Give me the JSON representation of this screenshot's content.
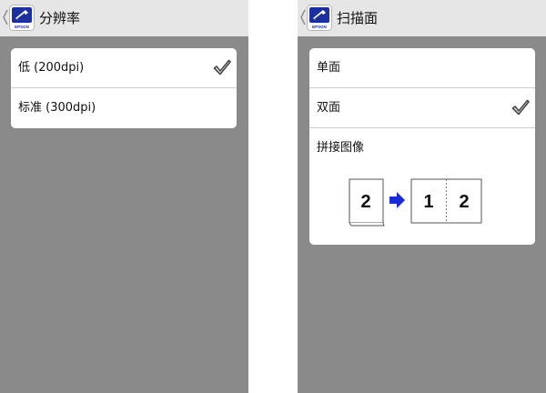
{
  "screens": [
    {
      "title": "分辨率",
      "logo_text": "EPSON",
      "options": [
        {
          "label": "低 (200dpi)",
          "selected": true
        },
        {
          "label": "标准 (300dpi)",
          "selected": false
        }
      ]
    },
    {
      "title": "扫描面",
      "logo_text": "EPSON",
      "options": [
        {
          "label": "单面",
          "selected": false
        },
        {
          "label": "双面",
          "selected": true
        }
      ],
      "merge": {
        "label": "拼接图像",
        "source_page": "2",
        "result_pages": [
          "1",
          "2"
        ]
      }
    }
  ],
  "colors": {
    "header_bg": "#e6e6e6",
    "body_bg": "#8a8a8a",
    "card_bg": "#ffffff",
    "arrow": "#1a2ad8",
    "logo": "#1b2fa0"
  }
}
